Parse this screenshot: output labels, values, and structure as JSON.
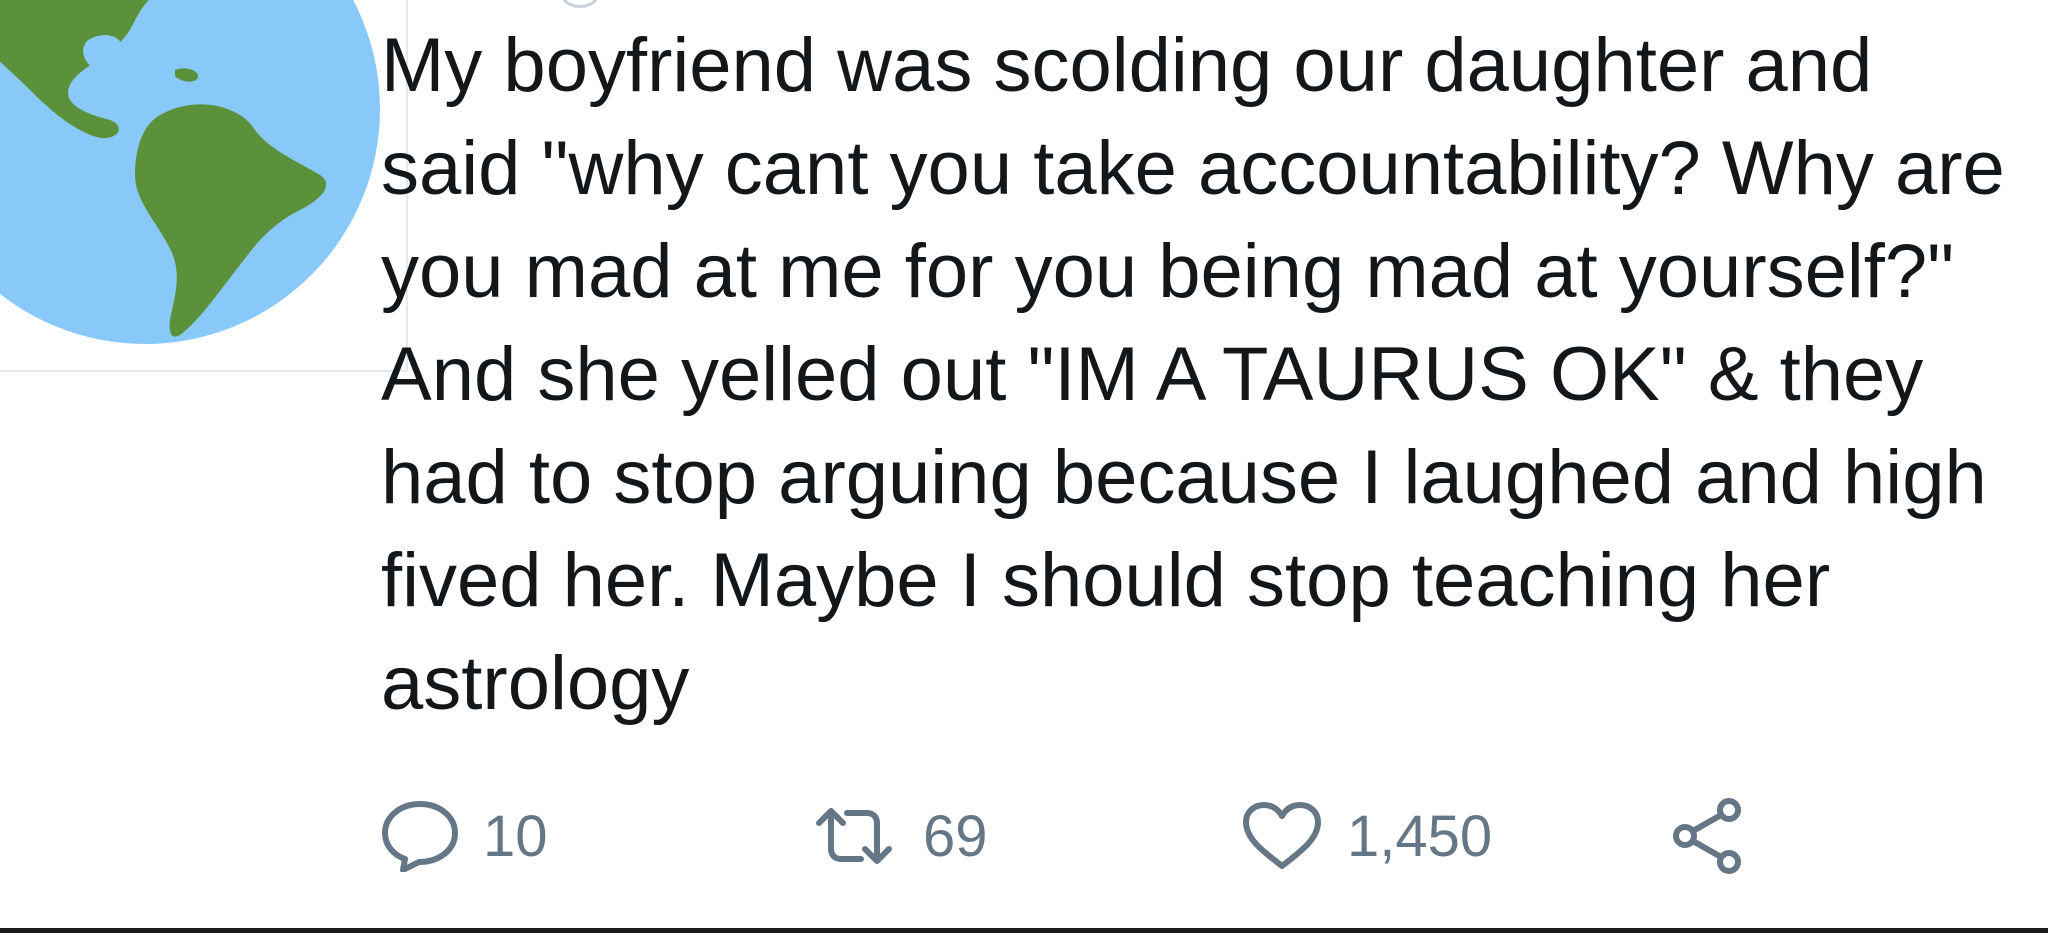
{
  "tweet": {
    "text": "My boyfriend was scolding our daughter and said \"why cant you take accountability? Why are you mad at me for you being mad at yourself?\" And she yelled out \"IM A TAURUS OK\" & they had to stop arguing because I laughed and high fived her. Maybe I should stop teaching her astrology"
  },
  "actions": {
    "reply": {
      "icon": "reply-icon",
      "count": "10"
    },
    "retweet": {
      "icon": "retweet-icon",
      "count": "69"
    },
    "like": {
      "icon": "heart-icon",
      "count": "1,450"
    },
    "share": {
      "icon": "share-icon"
    }
  },
  "avatar": {
    "icon": "globe-americas-icon"
  },
  "colors": {
    "text": "#14171a",
    "icon": "#657786",
    "globe_ocean": "#88c9f9",
    "globe_land": "#5c913b",
    "divider": "#e6e9ec"
  }
}
